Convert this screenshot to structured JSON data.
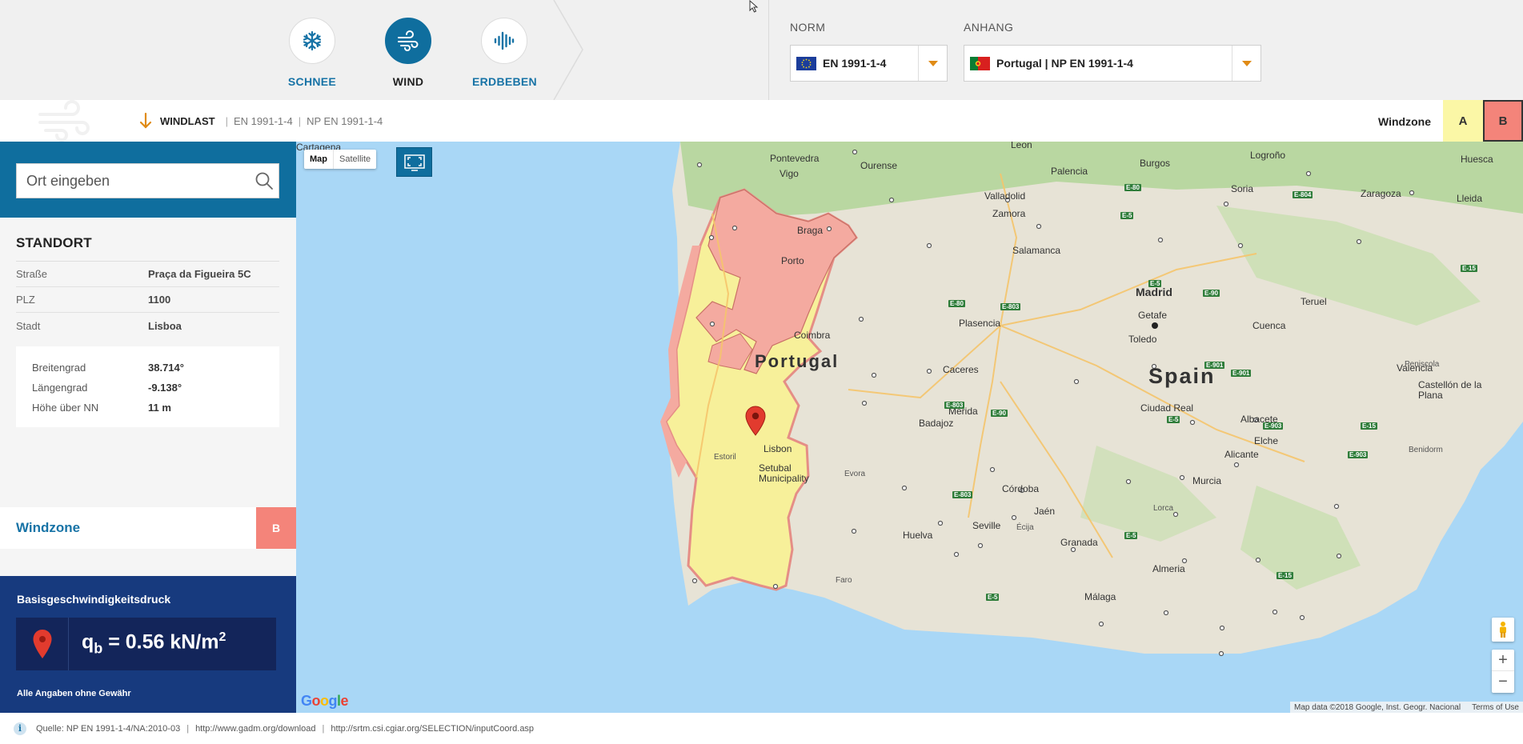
{
  "modes": [
    {
      "label": "SCHNEE",
      "icon": "snowflake-icon",
      "active": false
    },
    {
      "label": "WIND",
      "icon": "wind-icon",
      "active": true
    },
    {
      "label": "ERDBEBEN",
      "icon": "seismic-icon",
      "active": false
    }
  ],
  "norm": {
    "title": "NORM",
    "value": "EN 1991-1-4",
    "flag": "eu-flag-icon"
  },
  "anhang": {
    "title": "ANHANG",
    "value": "Portugal | NP EN 1991-1-4",
    "flag": "portugal-flag-icon"
  },
  "subheader": {
    "section": "WINDLAST",
    "crumbs": [
      "EN 1991-1-4",
      "NP EN 1991-1-4"
    ],
    "windzone_label": "Windzone",
    "zones": [
      "A",
      "B"
    ],
    "selected_zone": "B"
  },
  "search": {
    "placeholder": "Ort eingeben"
  },
  "standort": {
    "title": "STANDORT",
    "rows": [
      {
        "key": "Straße",
        "value": "Praça da Figueira 5C"
      },
      {
        "key": "PLZ",
        "value": "1100"
      },
      {
        "key": "Stadt",
        "value": "Lisboa"
      }
    ],
    "coords": [
      {
        "key": "Breitengrad",
        "value": "38.714°"
      },
      {
        "key": "Längengrad",
        "value": "-9.138°"
      },
      {
        "key": "Höhe über NN",
        "value": "11 m"
      }
    ]
  },
  "windzone": {
    "label": "Windzone",
    "value": "B"
  },
  "qb": {
    "title": "Basisgeschwindigkeitsdruck",
    "symbol": "q",
    "subscript": "b",
    "equals": "= 0.56 kN/m",
    "exponent": "2",
    "note": "Alle Angaben ohne Gewähr"
  },
  "map": {
    "type_buttons": [
      "Map",
      "Satellite"
    ],
    "country_labels": [
      "Portugal",
      "Spain"
    ],
    "cities": [
      "Pontevedra",
      "Ourense",
      "Vigo",
      "Braga",
      "Porto",
      "Coimbra",
      "Lisbon",
      "Setubal Municipality",
      "Evora",
      "Faro",
      "Leon",
      "Burgos",
      "Palencia",
      "Valladolid",
      "Zamora",
      "Salamanca",
      "Madrid",
      "Getafe",
      "Toledo",
      "Plasencia",
      "Caceres",
      "Mérida",
      "Badajoz",
      "Ciudad Real",
      "Albacete",
      "Valencia",
      "Cuenca",
      "Teruel",
      "Zaragoza",
      "Lleida",
      "Huesca",
      "Logroño",
      "Soria",
      "Córdoba",
      "Jaén",
      "Seville",
      "Huelva",
      "Écija",
      "Granada",
      "Murcia",
      "Cartagena",
      "Alicante",
      "Elche",
      "Almeria",
      "Málaga",
      "Castellón de la Plana",
      "Peniscola",
      "Benidorm",
      "Lorca",
      "Estoril"
    ],
    "attribution": "Map data ©2018 Google, Inst. Geogr. Nacional",
    "terms": "Terms of Use",
    "logo": "Google"
  },
  "footer": {
    "source_prefix": "Quelle:",
    "source": "NP EN 1991-1-4/NA:2010-03",
    "links": [
      "http://www.gadm.org/download",
      "http://srtm.csi.cgiar.org/SELECTION/inputCoord.asp"
    ]
  },
  "colors": {
    "primary": "#0f6e9e",
    "zone_a": "#fbf7a6",
    "zone_b": "#f4847a",
    "qb_panel": "#173a7e",
    "accent": "#e08b16"
  }
}
